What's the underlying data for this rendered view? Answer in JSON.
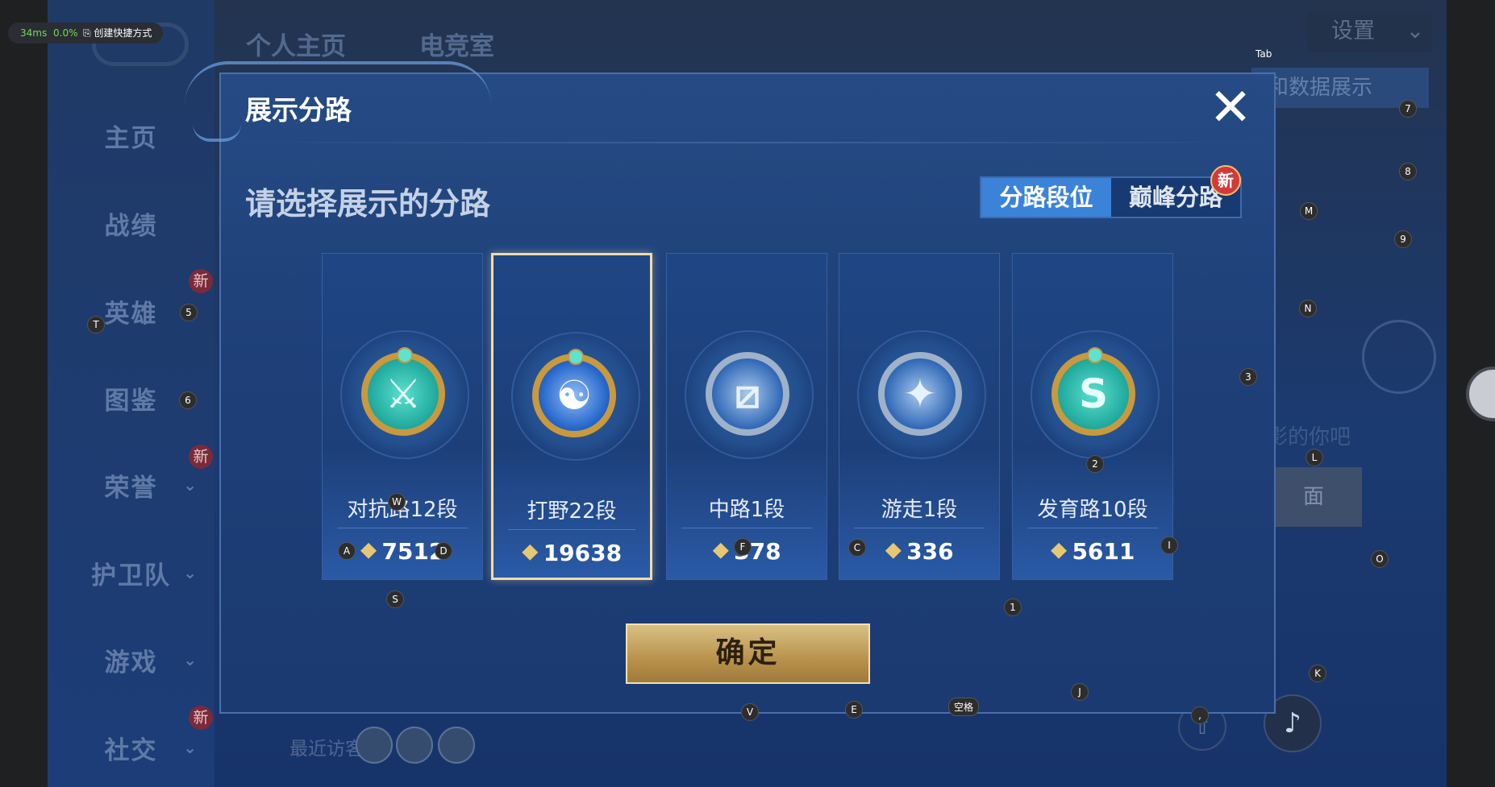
{
  "perf": {
    "latency": "34ms",
    "packet_loss": "0.0%",
    "shortcut_label": "创建快捷方式"
  },
  "background": {
    "top_tabs": [
      "个人主页",
      "电竞室"
    ],
    "settings_label": "设置",
    "right_banner": "和数据展示",
    "right_hint": "影的你吧",
    "right_button": "面",
    "sidebar": [
      {
        "label": "主页",
        "new": false,
        "chevron": false
      },
      {
        "label": "战绩",
        "new": false,
        "chevron": false
      },
      {
        "label": "英雄",
        "new": true,
        "chevron": false
      },
      {
        "label": "图鉴",
        "new": false,
        "chevron": false
      },
      {
        "label": "荣誉",
        "new": true,
        "chevron": true
      },
      {
        "label": "护卫队",
        "new": false,
        "chevron": true
      },
      {
        "label": "游戏",
        "new": false,
        "chevron": true
      },
      {
        "label": "社交",
        "new": true,
        "chevron": true
      }
    ],
    "new_badge": "新",
    "recent_visitors_label": "最近访客>"
  },
  "dialog": {
    "title": "展示分路",
    "prompt": "请选择展示的分路",
    "segments": {
      "active": "分路段位",
      "inactive": "巅峰分路",
      "new_badge": "新"
    },
    "cards": [
      {
        "label": "对抗路12段",
        "score": "7512",
        "emblem": "gold-green",
        "glyph": "⚔"
      },
      {
        "label": "打野22段",
        "score": "19638",
        "emblem": "gold-blue",
        "glyph": "☯",
        "selected": true
      },
      {
        "label": "中路1段",
        "score": "378",
        "emblem": "silver",
        "glyph": "⧄"
      },
      {
        "label": "游走1段",
        "score": "336",
        "emblem": "silver",
        "glyph": "✦"
      },
      {
        "label": "发育路10段",
        "score": "5611",
        "emblem": "gold-green",
        "glyph": "S"
      }
    ],
    "confirm_label": "确定"
  },
  "key_hints": {
    "tab": "Tab",
    "k7": "7",
    "k8": "8",
    "kM": "M",
    "k9": "9",
    "kN": "N",
    "k3": "3",
    "kL": "L",
    "kO": "O",
    "kK": "K",
    "kT": "T",
    "k5": "5",
    "k6": "6",
    "kW": "W",
    "kA": "A",
    "kD": "D",
    "kF": "F",
    "kC": "C",
    "kI": "I",
    "k2": "2",
    "kS": "S",
    "k1": "1",
    "kJ": "J",
    "kV": "V",
    "kE": "E",
    "space": "空格",
    "comma": ","
  }
}
